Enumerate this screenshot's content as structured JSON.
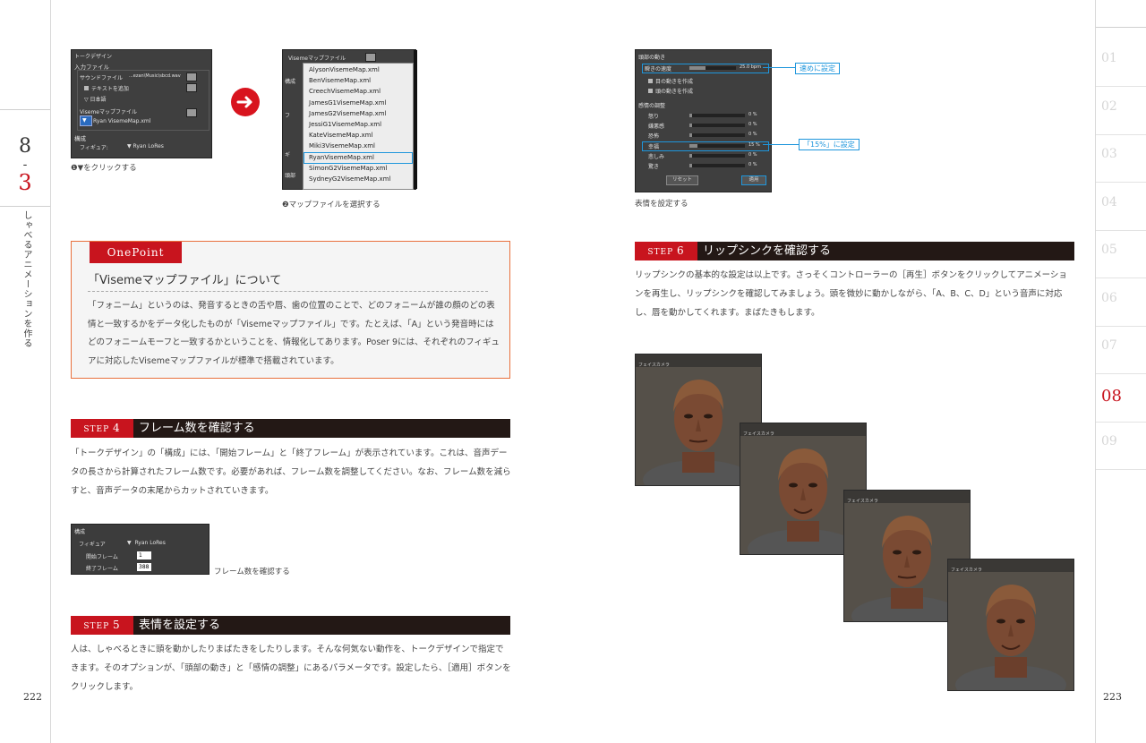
{
  "chapter": {
    "number": "8-3",
    "title": "しゃべるアニメーションを作る"
  },
  "pages": {
    "left": "222",
    "right": "223"
  },
  "side_tabs": [
    {
      "label": "01",
      "active": false
    },
    {
      "label": "02",
      "active": false
    },
    {
      "label": "03",
      "active": false
    },
    {
      "label": "04",
      "active": false
    },
    {
      "label": "05",
      "active": false
    },
    {
      "label": "06",
      "active": false
    },
    {
      "label": "07",
      "active": false
    },
    {
      "label": "08",
      "active": true
    },
    {
      "label": "09",
      "active": false
    }
  ],
  "shot1": {
    "title": "トークデザイン",
    "input_label": "入力ファイル",
    "sound_label": "サウンドファイル",
    "sound_path": "...ezan\\Music\\sbcd.wav",
    "text_add": "テキストを追加",
    "lang": "日本語",
    "viseme_label": "Visemeマップファイル",
    "viseme_file": "Ryan VisemeMap.xml",
    "compose": "構成",
    "figure_label": "フィギュア:",
    "figure_value": "Ryan LoRes",
    "caption": "❶▼をクリックする"
  },
  "shot2": {
    "header": "Visemeマップファイル",
    "side_labels": [
      "構成",
      "フ",
      "ギ",
      "頭部"
    ],
    "items": [
      "AlysonVisemeMap.xml",
      "BenVisemeMap.xml",
      "CreechVisemeMap.xml",
      "JamesG1VisemeMap.xml",
      "JamesG2VisemeMap.xml",
      "JessiG1VisemeMap.xml",
      "KateVisemeMap.xml",
      "Miki3VisemeMap.xml",
      "RyanVisemeMap.xml",
      "SimonG2VisemeMap.xml",
      "SydneyG2VisemeMap.xml"
    ],
    "selected": "RyanVisemeMap.xml",
    "caption": "❷マップファイルを選択する"
  },
  "onepoint": {
    "label": "OnePoint",
    "title": "「Visemeマップファイル」について",
    "body": "「フォニーム」というのは、発音するときの舌や唇、歯の位置のことで、どのフォニームが誰の顔のどの表情と一致するかをデータ化したものが「Visemeマップファイル」です。たとえば、「A」という発音時にはどのフォニームモーフと一致するかということを、情報化してあります。Poser 9には、それぞれのフィギュアに対応したVisemeマップファイルが標準で搭載されています。"
  },
  "step4": {
    "label": "STEP",
    "num": "4",
    "title": "フレーム数を確認する",
    "body": "「トークデザイン」の「構成」には、「開始フレーム」と「終了フレーム」が表示されています。これは、音声データの長さから計算されたフレーム数です。必要があれば、フレーム数を調整してください。なお、フレーム数を減らすと、音声データの末尾からカットされていきます。",
    "shot": {
      "compose": "構成",
      "figure_label": "フィギュア",
      "figure_value": "Ryan LoRes",
      "start_label": "開始フレーム",
      "start_value": "1",
      "end_label": "終了フレーム",
      "end_value": "388"
    },
    "caption": "フレーム数を確認する"
  },
  "step5": {
    "label": "STEP",
    "num": "5",
    "title": "表情を設定する",
    "body": "人は、しゃべるときに頭を動かしたりまばたきをしたりします。そんな何気ない動作を、トークデザインで指定できます。そのオプションが、「頭部の動き」と「感情の調整」にあるパラメータです。設定したら、［適用］ボタンをクリックします。"
  },
  "shot3": {
    "head_section": "頭部の動き",
    "speed_label": "瞬きの速度",
    "speed_value": "25.0 bpm",
    "eye_check": "目の動きを作成",
    "head_check": "頭の動きを作成",
    "emotion_section": "感情の調整",
    "emotions": [
      {
        "label": "怒り",
        "value": "0 %",
        "level": 0.05
      },
      {
        "label": "嫌悪感",
        "value": "0 %",
        "level": 0.05
      },
      {
        "label": "恐怖",
        "value": "0 %",
        "level": 0.05
      },
      {
        "label": "幸福",
        "value": "15 %",
        "level": 0.15
      },
      {
        "label": "悲しみ",
        "value": "0 %",
        "level": 0.05
      },
      {
        "label": "驚き",
        "value": "0 %",
        "level": 0.05
      }
    ],
    "reset": "リセット",
    "apply": "適用",
    "callout_speed": "速めに設定",
    "callout_happy": "「15%」に設定",
    "caption": "表情を設定する"
  },
  "step6": {
    "label": "STEP",
    "num": "6",
    "title": "リップシンクを確認する",
    "body": "リップシンクの基本的な設定は以上です。さっそくコントローラーの［再生］ボタンをクリックしてアニメーションを再生し、リップシンクを確認してみましょう。頭を微妙に動かしながら、「A、B、C、D」という音声に対応し、唇を動かしてくれます。まばたきもします。"
  },
  "viewport_label": "フェイスカメラ",
  "colors": {
    "accent_red": "#c8141e",
    "callout_blue": "#1e96dc",
    "step_dark": "#231815",
    "onepoint_border": "#e8703d"
  }
}
